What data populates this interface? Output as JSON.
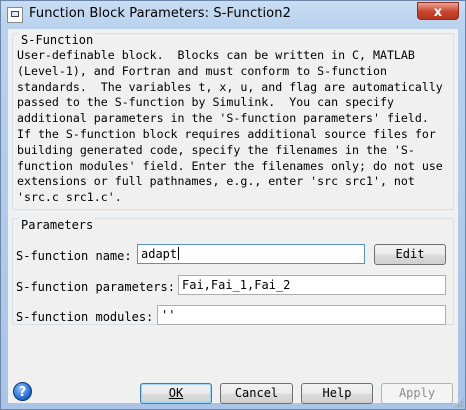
{
  "window": {
    "title": "Function Block Parameters: S-Function2",
    "close_glyph": "x"
  },
  "sfunction_group": {
    "title": "S-Function",
    "description": "User-definable block.  Blocks can be written in C, MATLAB\n(Level-1), and Fortran and must conform to S-function\nstandards.  The variables t, x, u, and flag are automatically\npassed to the S-function by Simulink.  You can specify\nadditional parameters in the 'S-function parameters' field.\nIf the S-function block requires additional source files for\nbuilding generated code, specify the filenames in the 'S-\nfunction modules' field. Enter the filenames only; do not use\nextensions or full pathnames, e.g., enter 'src src1', not\n'src.c src1.c'."
  },
  "parameters_group": {
    "title": "Parameters",
    "name_label": "S-function name:",
    "name_value": "adapt",
    "edit_label": "Edit",
    "params_label": "S-function parameters:",
    "params_value": "Fai,Fai_1,Fai_2",
    "modules_label": "S-function modules:",
    "modules_value": "''"
  },
  "buttons": {
    "ok": "OK",
    "cancel": "Cancel",
    "help": "Help",
    "apply": "Apply"
  },
  "icons": {
    "help": "?"
  }
}
